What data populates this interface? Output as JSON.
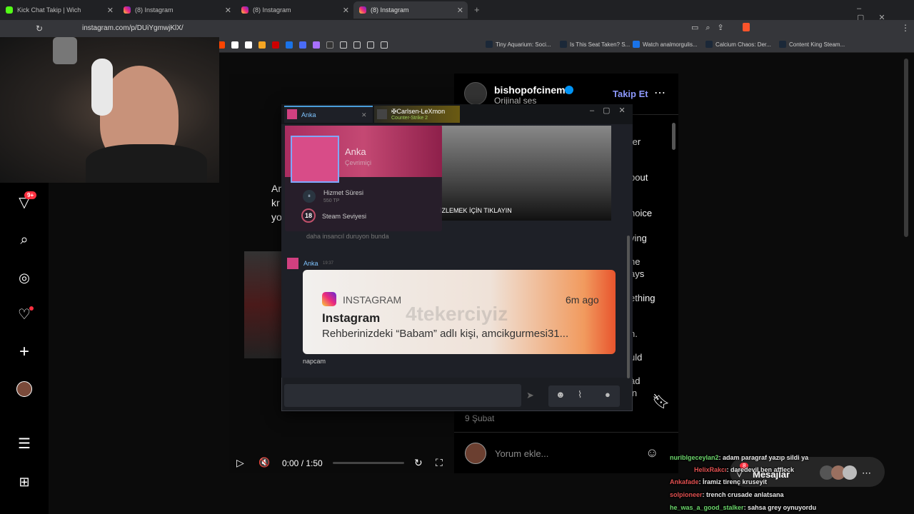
{
  "browser": {
    "tabs": [
      {
        "label": "Kick Chat Takip | Wich"
      },
      {
        "label": "(8) Instagram"
      },
      {
        "label": "(8) Instagram"
      },
      {
        "label": "(8) Instagram"
      }
    ],
    "url": "instagram.com/p/DUiYgmwjKlX/",
    "bookmarks": [
      {
        "label": "Tiny Aquarium: Soci..."
      },
      {
        "label": "Is This Seat Taken? S..."
      },
      {
        "label": "Watch analmorgulis..."
      },
      {
        "label": "Calcium Chaos: Der..."
      },
      {
        "label": "Content King Steam..."
      }
    ]
  },
  "instagram": {
    "nav_badge": "9+",
    "post": {
      "username": "bishopofcinema",
      "audio": "Orijinal ses",
      "follow": "Takip Et",
      "date": "9 Şubat",
      "comment_placeholder": "Yorum ekle...",
      "video_time": "0:00 / 1:50",
      "caption_fragments": [
        "ter",
        "bout",
        "hoice",
        "ying",
        "ne",
        "ays",
        "ething",
        "n.",
        "uld",
        "ad in"
      ],
      "video_text_fragments": [
        "An",
        "kr",
        "yo"
      ]
    },
    "messages_label": "Mesajlar",
    "messages_badge": "8"
  },
  "steam": {
    "tabs": [
      {
        "name": "Anka"
      },
      {
        "name": "✠Carlsen-LeXmon",
        "sub": "Counter-Strike 2"
      }
    ],
    "popup": {
      "name": "Anka",
      "status": "Çevrimiçi",
      "service_label": "Hizmet Süresi",
      "service_value": "550 TP",
      "level": "18",
      "level_label": "Steam Seviyesi"
    },
    "click_text": "İZLEMEK İÇİN TIKLAYIN",
    "faded_message": "daha insancıl duruyon bunda",
    "message_author": "Anka",
    "message_time": "19:37",
    "notification": {
      "app": "INSTAGRAM",
      "time": "6m ago",
      "title": "Instagram",
      "body": "Rehberinizdeki “Babam” adlı kişi, amcikgurmesi31...",
      "watermark": "4tekerciyiz"
    },
    "caption": "napcam"
  },
  "stream_chat": [
    {
      "user": "nuriblgeceylan2",
      "text": ": adam paragraf yazıp sildi ya",
      "color": "#6bd66b"
    },
    {
      "user": "HelixRakcı",
      "text": ": daredevil ben affleck",
      "color": "#e05050"
    },
    {
      "user": "Ankafade",
      "text": ": İramiz tirenç kruseyit",
      "color": "#e05050"
    },
    {
      "user": "solpioneer",
      "text": ": trench crusade anlatsana",
      "color": "#e05050"
    },
    {
      "user": "he_was_a_good_stalker",
      "text": ": sahsa grey oynuyordu",
      "color": "#6bd66b"
    }
  ]
}
